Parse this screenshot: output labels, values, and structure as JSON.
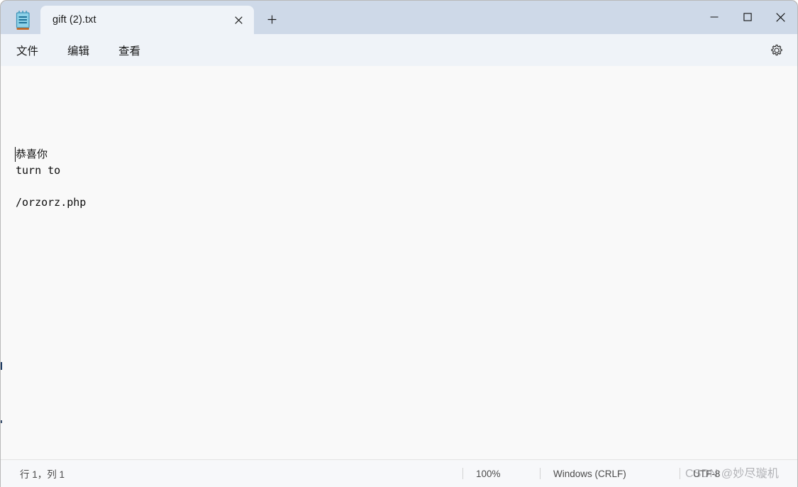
{
  "window": {
    "app_icon": "notepad-icon",
    "controls": {
      "minimize": "—",
      "maximize": "☐",
      "close": "✕"
    }
  },
  "tabs": [
    {
      "label": "gift (2).txt",
      "close_icon": "close-icon",
      "active": true
    }
  ],
  "newtab": {
    "label": "+"
  },
  "menubar": {
    "items": [
      {
        "label": "文件"
      },
      {
        "label": "编辑"
      },
      {
        "label": "查看"
      }
    ],
    "settings_icon": "gear-icon"
  },
  "editor": {
    "content": "恭喜你\nturn to\n\n/orzorz.php",
    "caret_visible": true
  },
  "statusbar": {
    "line_col": "行 1，列 1",
    "zoom": "100%",
    "line_ending": "Windows (CRLF)",
    "encoding": "UTF-8"
  },
  "watermark": {
    "text": "CSDN @妙尽璇机"
  },
  "colors": {
    "titlebar": "#ced9e8",
    "menubar": "#eff3f8",
    "tab_active": "#eff3f8",
    "editor_bg": "#f9f9f9",
    "statusbar_bg": "#f7f8fa",
    "text": "#0d0d0d"
  }
}
